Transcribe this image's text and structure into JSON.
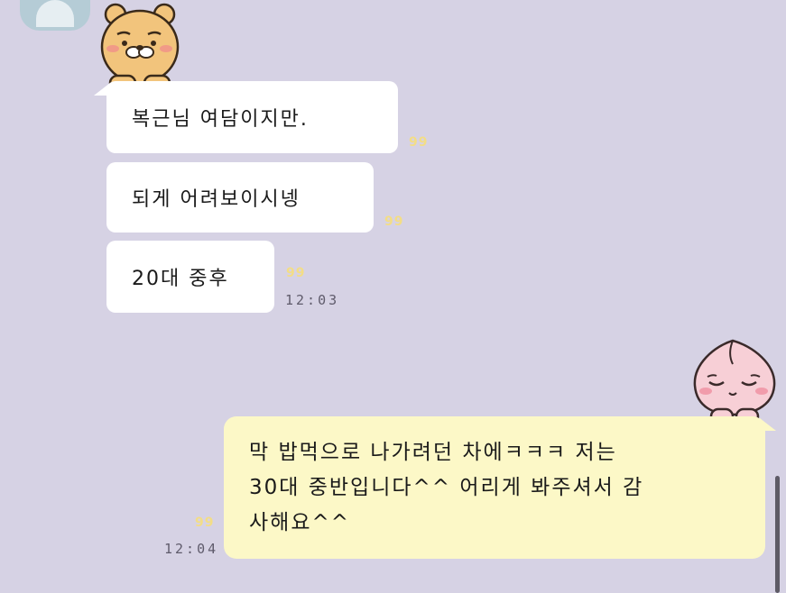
{
  "stickers": {
    "ryan": "ryan-bear-sticker",
    "apeach": "apeach-peach-sticker"
  },
  "incoming": [
    {
      "text": "복근님 여담이지만.",
      "unread": "99"
    },
    {
      "text": "되게 어려보이시넹",
      "unread": "99"
    },
    {
      "text": "20대 중후",
      "unread": "99",
      "time": "12:03"
    }
  ],
  "outgoing": {
    "lines": [
      "막 밥먹으로 나가려던 차에ㅋㅋㅋ 저는",
      "30대 중반입니다^^ 어리게 봐주셔서 감",
      "사해요^^"
    ],
    "unread": "99",
    "time": "12:04"
  },
  "colors": {
    "background": "#d6d2e4",
    "incoming_bubble": "#ffffff",
    "outgoing_bubble": "#fcf8c7",
    "unread_count": "#f3dd86"
  }
}
